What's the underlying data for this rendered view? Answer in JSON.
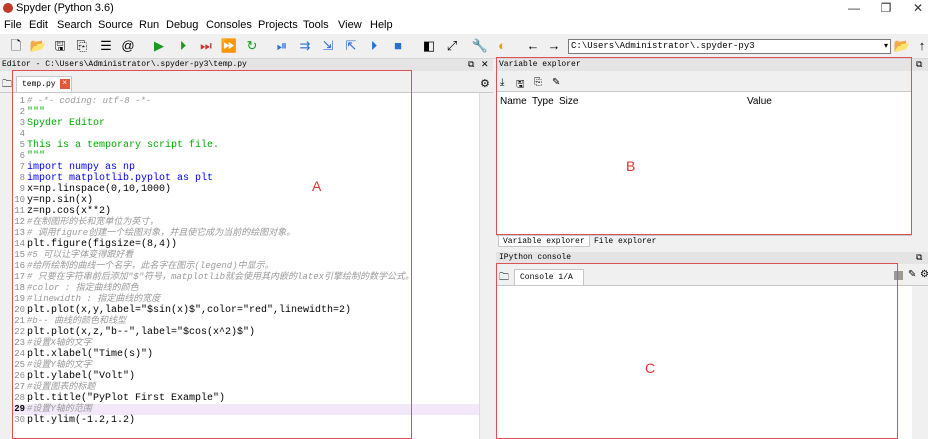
{
  "window": {
    "title": "Spyder (Python 3.6)",
    "controls": [
      "—",
      "❐",
      "✕"
    ]
  },
  "menu": [
    "File",
    "Edit",
    "Search",
    "Source",
    "Run",
    "Debug",
    "Consoles",
    "Projects",
    "Tools",
    "View",
    "Help"
  ],
  "toolbar": {
    "path": "C:\\Users\\Administrator\\.spyder-py3"
  },
  "editor": {
    "title": "Editor - C:\\Users\\Administrator\\.spyder-py3\\temp.py",
    "tab": "temp.py",
    "lines": [
      {
        "n": "1",
        "text": "# -*- coding: utf-8 -*-",
        "cls": "c-comment"
      },
      {
        "n": "2",
        "text": "\"\"\"",
        "cls": "c-string"
      },
      {
        "n": "3",
        "text": "Spyder Editor",
        "cls": "c-string"
      },
      {
        "n": "4",
        "text": "",
        "cls": "c-plain"
      },
      {
        "n": "5",
        "text": "This is a temporary script file.",
        "cls": "c-string"
      },
      {
        "n": "6",
        "text": "\"\"\"",
        "cls": "c-string"
      },
      {
        "n": "7",
        "text": "import numpy as np",
        "cls": "c-kw"
      },
      {
        "n": "8",
        "text": "import matplotlib.pyplot as plt",
        "cls": "c-kw"
      },
      {
        "n": "9",
        "text": "x=np.linspace(0,10,1000)",
        "cls": "c-plain"
      },
      {
        "n": "10",
        "text": "y=np.sin(x)",
        "cls": "c-plain"
      },
      {
        "n": "11",
        "text": "z=np.cos(x**2)",
        "cls": "c-plain"
      },
      {
        "n": "12",
        "text": "#在制图形的长和宽单位为英寸，",
        "cls": "c-comment"
      },
      {
        "n": "13",
        "text": "# 调用figure创建一个绘图对象，并且使它成为当前的绘图对象。",
        "cls": "c-comment"
      },
      {
        "n": "14",
        "text": "plt.figure(figsize=(8,4))",
        "cls": "c-plain"
      },
      {
        "n": "15",
        "text": "#5 可以让字体变得跟好看",
        "cls": "c-comment"
      },
      {
        "n": "16",
        "text": "#给所绘制的曲线一个名字，此名字在图示(legend)中显示。",
        "cls": "c-comment"
      },
      {
        "n": "17",
        "text": "# 只要在字符串前后添加\"$\"符号，matplotlib就会使用其内嵌的latex引擎绘制的数学公式。",
        "cls": "c-comment"
      },
      {
        "n": "18",
        "text": "#color : 指定曲线的颜色",
        "cls": "c-comment"
      },
      {
        "n": "19",
        "text": "#linewidth : 指定曲线的宽度",
        "cls": "c-comment"
      },
      {
        "n": "20",
        "text": "plt.plot(x,y,label=\"$sin(x)$\",color=\"red\",linewidth=2)",
        "cls": "c-plain"
      },
      {
        "n": "21",
        "text": "#b-- 曲线的颜色和线型",
        "cls": "c-comment"
      },
      {
        "n": "22",
        "text": "plt.plot(x,z,\"b--\",label=\"$cos(x^2)$\")",
        "cls": "c-plain"
      },
      {
        "n": "23",
        "text": "#设置X轴的文字",
        "cls": "c-comment"
      },
      {
        "n": "24",
        "text": "plt.xlabel(\"Time(s)\")",
        "cls": "c-plain"
      },
      {
        "n": "25",
        "text": "#设置Y轴的文字",
        "cls": "c-comment"
      },
      {
        "n": "26",
        "text": "plt.ylabel(\"Volt\")",
        "cls": "c-plain"
      },
      {
        "n": "27",
        "text": "#设置图表的标题",
        "cls": "c-comment"
      },
      {
        "n": "28",
        "text": "plt.title(\"PyPlot First Example\")",
        "cls": "c-plain"
      },
      {
        "n": "29",
        "text": "#设置Y轴的范围",
        "cls": "c-comment",
        "current": true
      },
      {
        "n": "30",
        "text": "plt.ylim(-1.2,1.2)",
        "cls": "c-plain"
      }
    ]
  },
  "variable_explorer": {
    "title": "Variable explorer",
    "columns": [
      "Name",
      "Type",
      "Size",
      "Value"
    ]
  },
  "bottom_tabs": [
    "Variable explorer",
    "File explorer"
  ],
  "ipython": {
    "title": "IPython console",
    "tab": "Console 1/A"
  },
  "annotations": [
    "A",
    "B",
    "C"
  ],
  "colors": {
    "annotation": "#e03030",
    "run": "#1a9a1a",
    "debug_blue": "#2a6fd6"
  }
}
